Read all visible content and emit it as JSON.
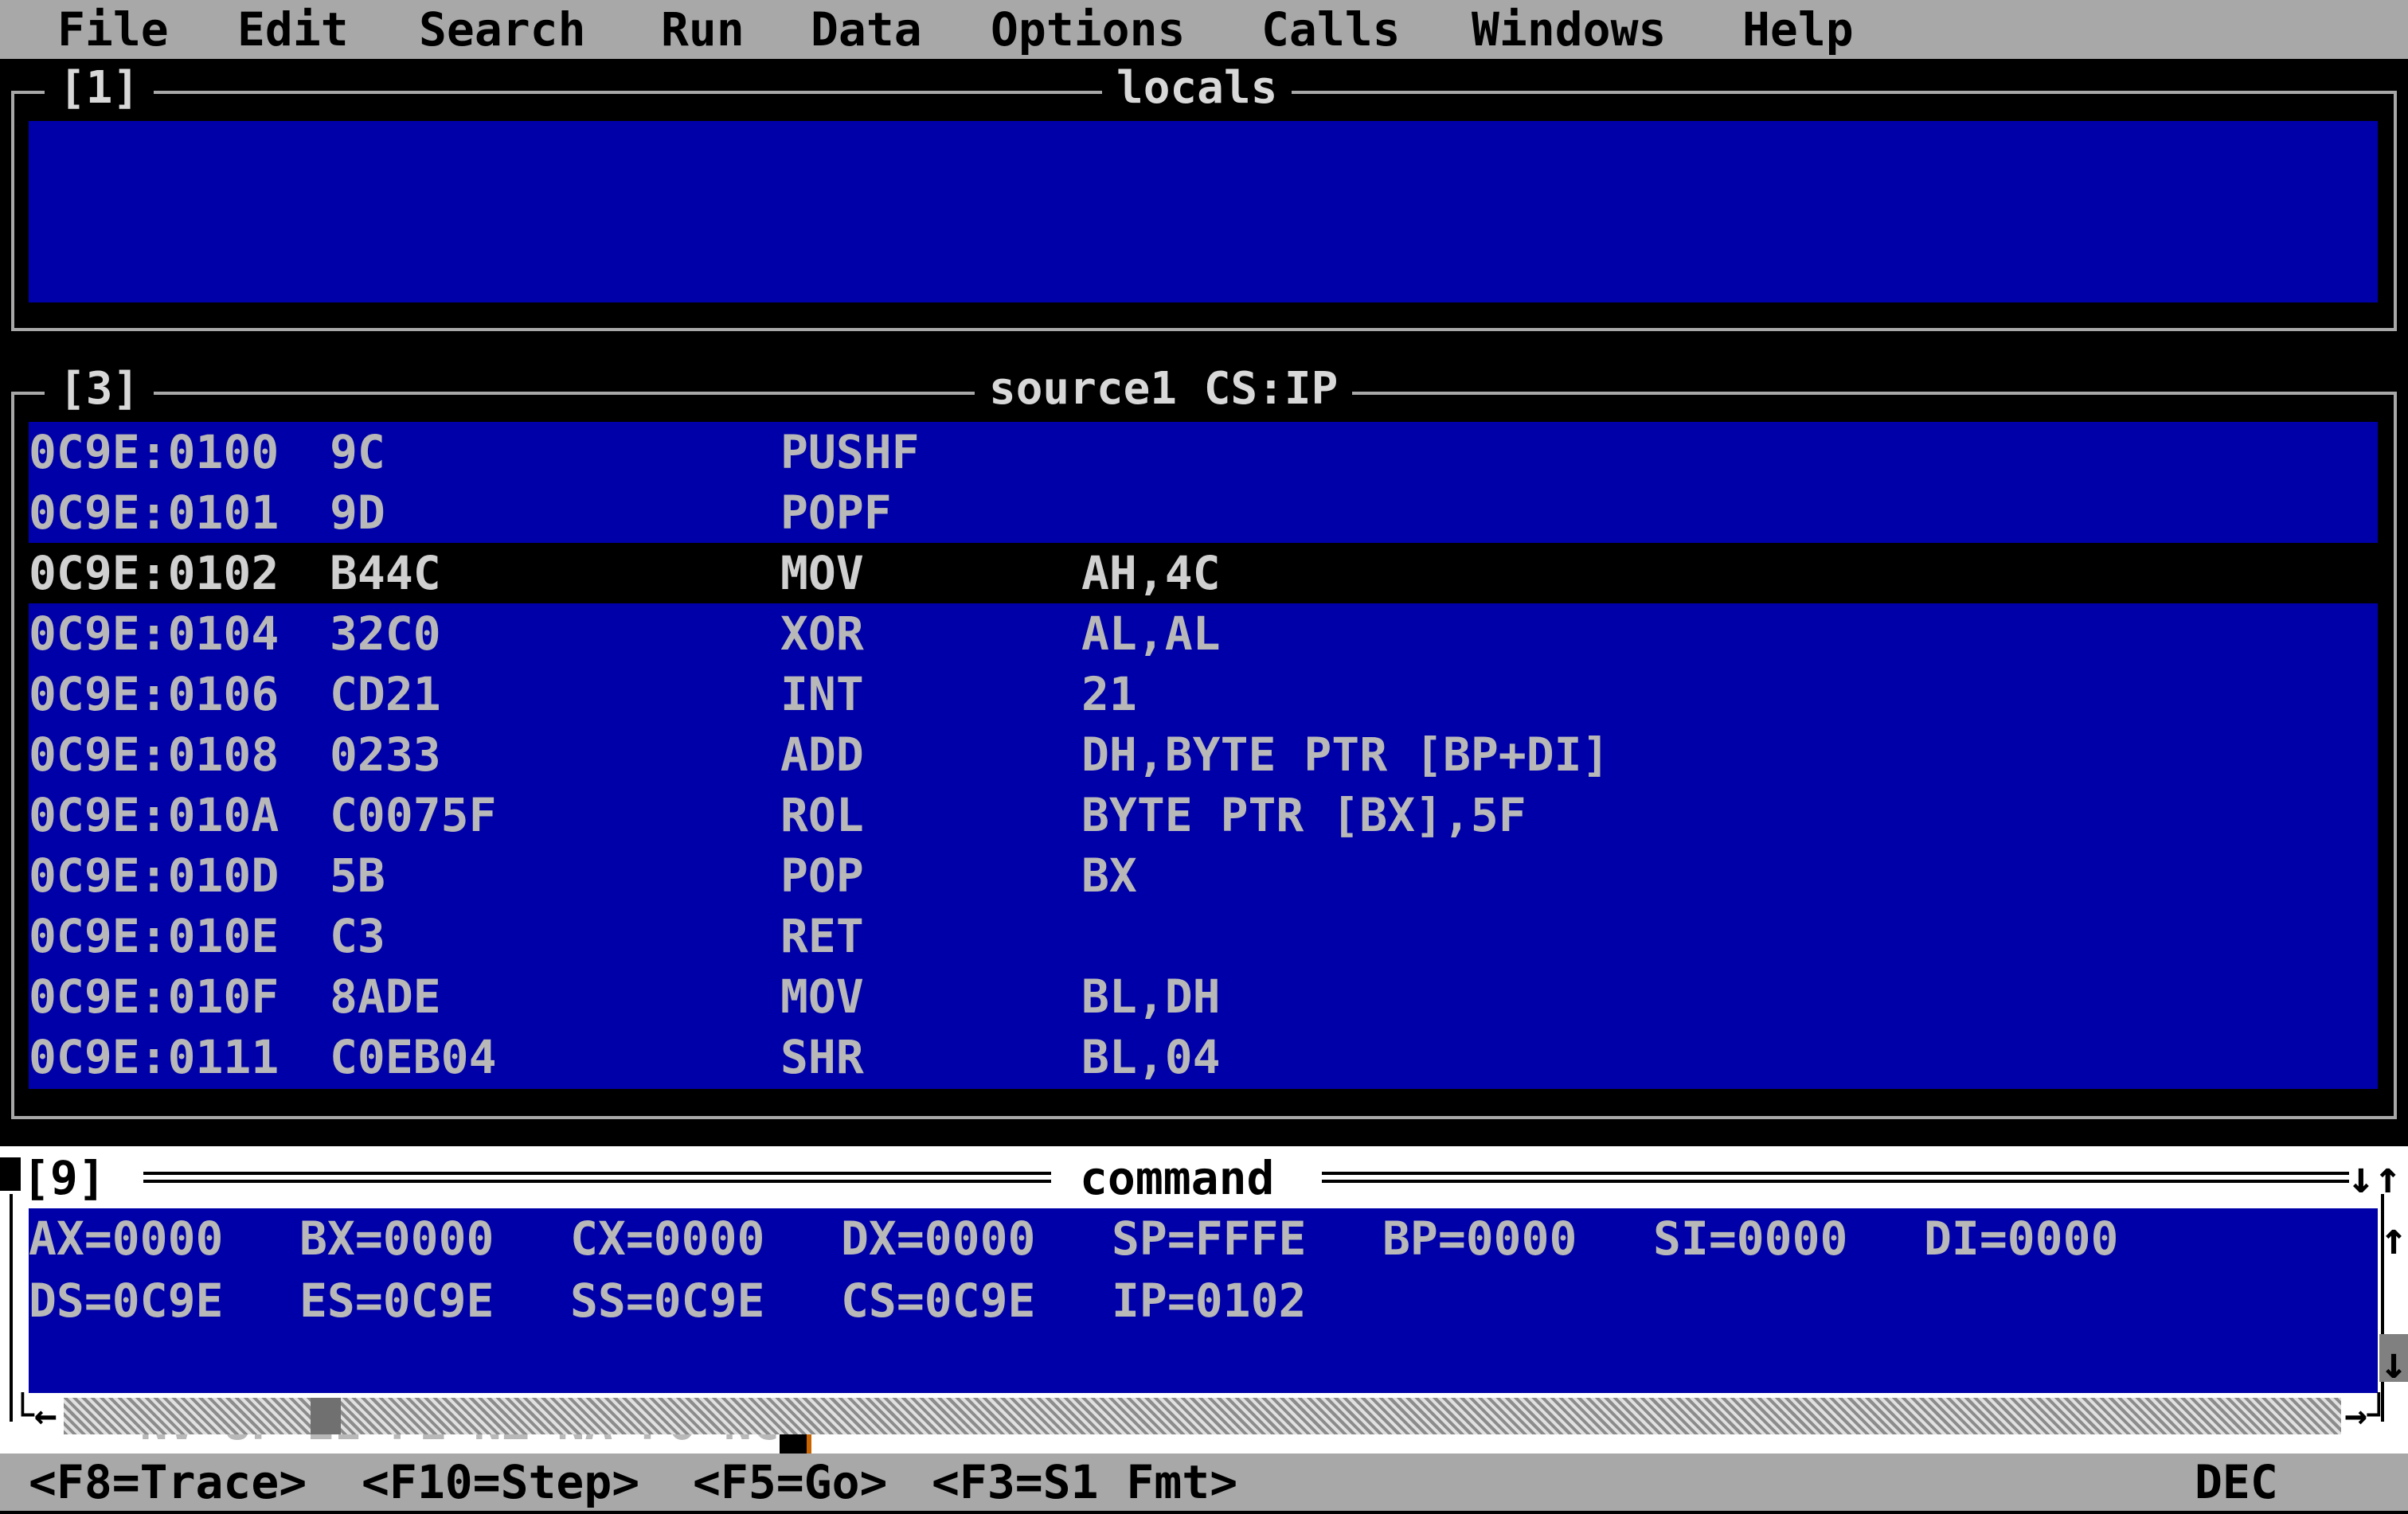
{
  "menu": [
    "File",
    "Edit",
    "Search",
    "Run",
    "Data",
    "Options",
    "Calls",
    "Windows",
    "Help"
  ],
  "locals_window": {
    "number": "[1]",
    "title": "locals"
  },
  "source_window": {
    "number": "[3]",
    "title": "source1 CS:IP",
    "rows": [
      {
        "addr": "0C9E:0100",
        "bytes": "9C",
        "mnemonic": "PUSHF",
        "operands": ""
      },
      {
        "addr": "0C9E:0101",
        "bytes": "9D",
        "mnemonic": "POPF",
        "operands": ""
      },
      {
        "addr": "0C9E:0102",
        "bytes": "B44C",
        "mnemonic": "MOV",
        "operands": "AH,4C"
      },
      {
        "addr": "0C9E:0104",
        "bytes": "32C0",
        "mnemonic": "XOR",
        "operands": "AL,AL"
      },
      {
        "addr": "0C9E:0106",
        "bytes": "CD21",
        "mnemonic": "INT",
        "operands": "21"
      },
      {
        "addr": "0C9E:0108",
        "bytes": "0233",
        "mnemonic": "ADD",
        "operands": "DH,BYTE PTR [BP+DI]"
      },
      {
        "addr": "0C9E:010A",
        "bytes": "C0075F",
        "mnemonic": "ROL",
        "operands": "BYTE PTR [BX],5F"
      },
      {
        "addr": "0C9E:010D",
        "bytes": "5B",
        "mnemonic": "POP",
        "operands": "BX"
      },
      {
        "addr": "0C9E:010E",
        "bytes": "C3",
        "mnemonic": "RET",
        "operands": ""
      },
      {
        "addr": "0C9E:010F",
        "bytes": "8ADE",
        "mnemonic": "MOV",
        "operands": "BL,DH"
      },
      {
        "addr": "0C9E:0111",
        "bytes": "C0EB04",
        "mnemonic": "SHR",
        "operands": "BL,04"
      }
    ],
    "current_row_index": 2
  },
  "command_window": {
    "number": "[9]",
    "title": "command",
    "registers_line1": [
      "AX=0000",
      "BX=0000",
      "CX=0000",
      "DX=0000",
      "SP=FFFE",
      "BP=0000",
      "SI=0000",
      "DI=0000"
    ],
    "registers_line2": [
      "DS=0C9E",
      "ES=0C9E",
      "SS=0C9E",
      "CS=0C9E",
      "IP=0102"
    ],
    "flags_line": "NV UP EI PL NZ NA PO NC",
    "scroll_position": 0.11
  },
  "status_bar": {
    "keys": [
      "<F8=Trace>",
      "<F10=Step>",
      "<F5=Go>",
      "<F3=S1 Fmt>"
    ],
    "mode": "DEC"
  },
  "colors": {
    "window_bg": "#0000a8",
    "menu_bg": "#a8a8a8",
    "text": "#b8b8b8"
  },
  "icons": {
    "close": "close-icon",
    "maximize": "maximize-restore-icon",
    "scroll_up": "scroll-up-arrow-icon",
    "scroll_down": "scroll-down-arrow-icon",
    "scroll_left": "scroll-left-arrow-icon",
    "scroll_right": "scroll-right-arrow-icon",
    "resize": "resize-corner-icon"
  }
}
